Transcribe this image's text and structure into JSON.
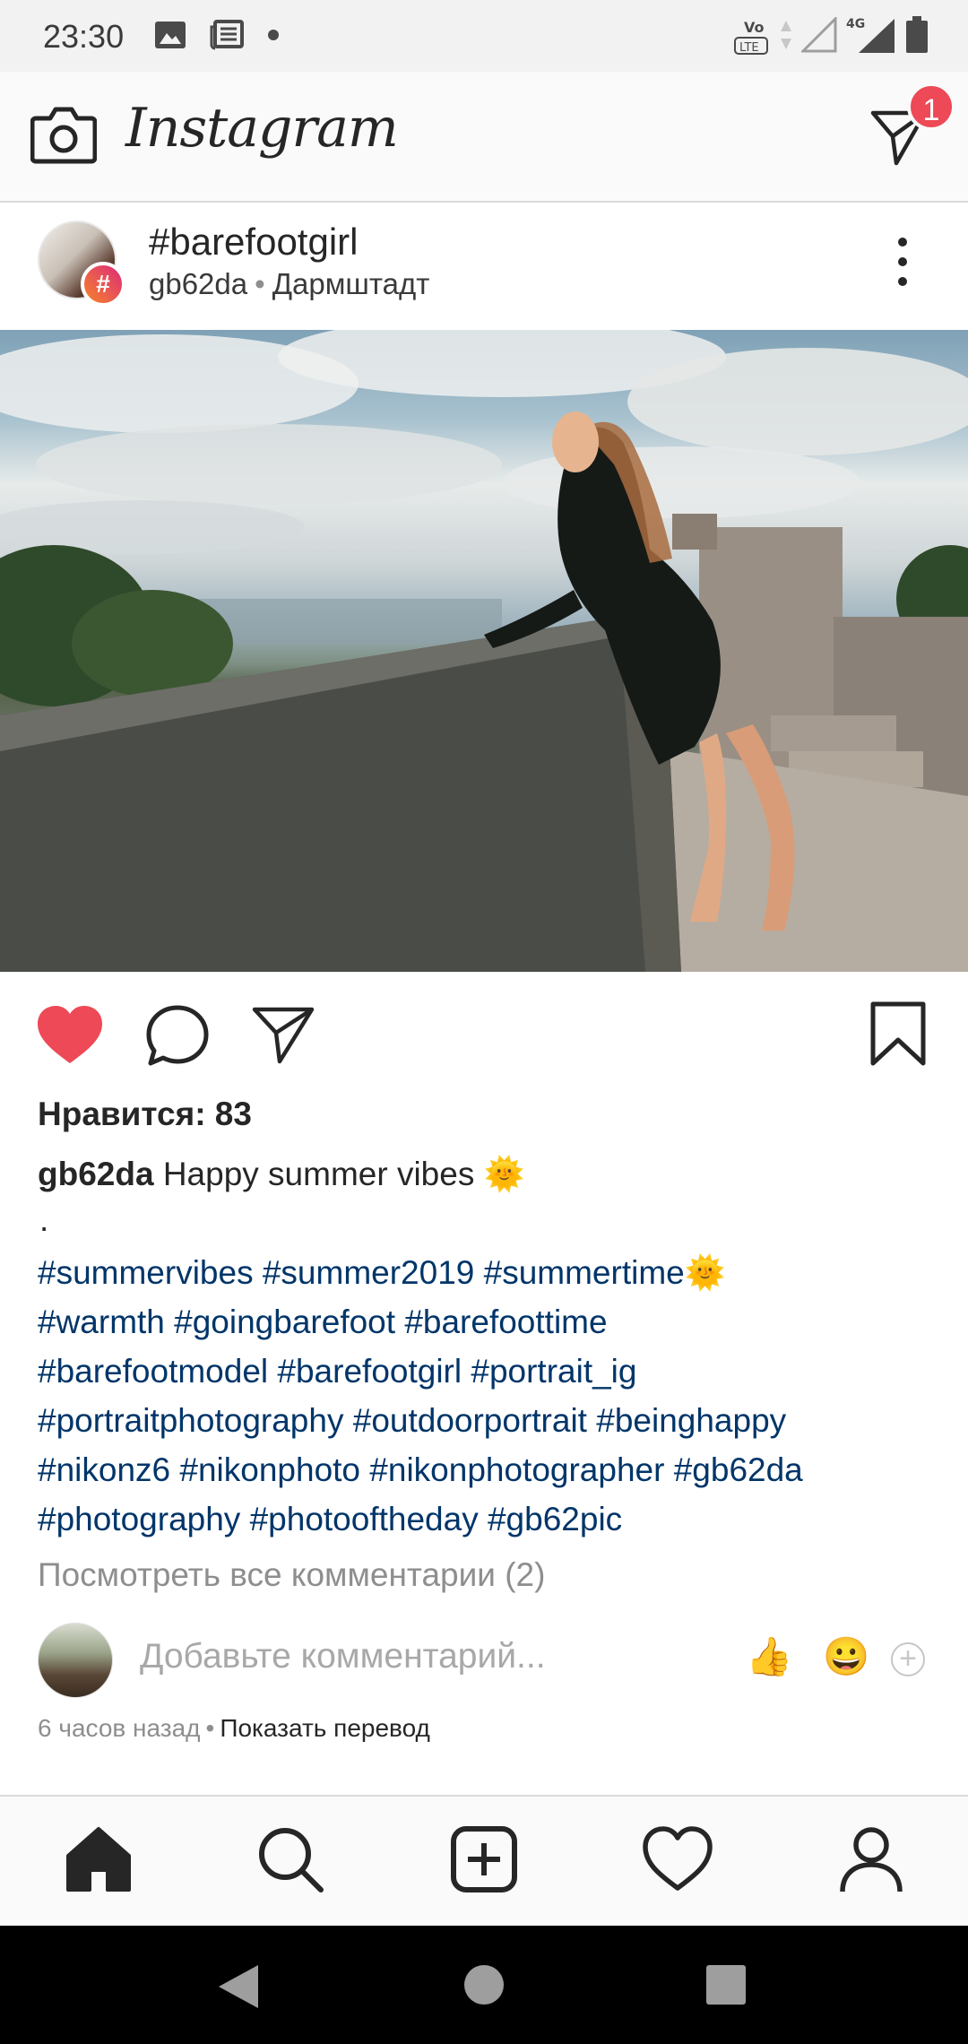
{
  "status_bar": {
    "time": "23:30",
    "network": "4G",
    "volte": "LTE"
  },
  "app_bar": {
    "brand": "Instagram",
    "dm_badge": "1",
    "icons": [
      "camera-icon",
      "direct-message-icon"
    ]
  },
  "post": {
    "title": "#barefootgirl",
    "author": "gb62da",
    "location": "Дармштадт",
    "badge_symbol": "#",
    "likes": "Нравится: 83",
    "caption_author": "gb62da",
    "caption_text": "Happy summer vibes 🌞",
    "caption_dot": ".",
    "hashtag_lines": [
      "#summervibes #summer2019 #summertime🌞",
      "#warmth #goingbarefoot #barefoottime",
      "#barefootmodel #barefootgirl #portrait_ig",
      "#portraitphotography #outdoorportrait #beinghappy",
      "#nikonz6 #nikonphoto #nikonphotographer #gb62da",
      "#photography #photooftheday #gb62pic"
    ],
    "view_comments": "Посмотреть все комментарии (2)",
    "comment_placeholder": "Добавьте комментарий...",
    "emoji_thumb": "👍",
    "emoji_grin": "😀",
    "add_emoji": "+",
    "time_ago": "6 часов назад",
    "separator": "•",
    "show_translation": "Показать перевод",
    "liked": true
  },
  "colors": {
    "like_red": "#ed4956",
    "hashtag_blue": "#003569",
    "muted_gray": "#8e8e8e"
  },
  "bottom_nav": [
    "home-icon",
    "search-icon",
    "new-post-icon",
    "activity-icon",
    "profile-icon"
  ],
  "system_nav": [
    "back-icon",
    "home-circle-icon",
    "recents-icon"
  ]
}
